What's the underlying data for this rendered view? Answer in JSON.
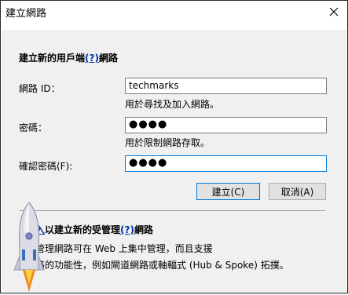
{
  "window": {
    "title": "建立網路",
    "close_glyph": "✕"
  },
  "section1": {
    "heading_pre": "建立新的用戶端",
    "help_mark": "(?)",
    "heading_post": "網路"
  },
  "form": {
    "network_id_label": "網路 ID：",
    "network_id_value": "techmarks",
    "network_id_hint": "用於尋找及加入網路。",
    "password_label": "密碼：",
    "password_value": "●●●●",
    "password_hint": "用於限制網路存取。",
    "confirm_label": "確認密碼(F):",
    "confirm_value": "●●●●"
  },
  "buttons": {
    "create": "建立(C)",
    "cancel": "取消(A)"
  },
  "section2": {
    "heading_link": "按入",
    "heading_mid": "以建立新的受管理",
    "help_mark": "(?)",
    "heading_post": "網路",
    "desc_line1": "受管理網路可在 Web 上集中管理，而且支援",
    "desc_line2": "網路的功能性，例如閘道網路或軸輻式 (Hub & Spoke) 拓撲。"
  },
  "icons": {
    "close": "close-icon",
    "mascot": "rocket-icon"
  }
}
